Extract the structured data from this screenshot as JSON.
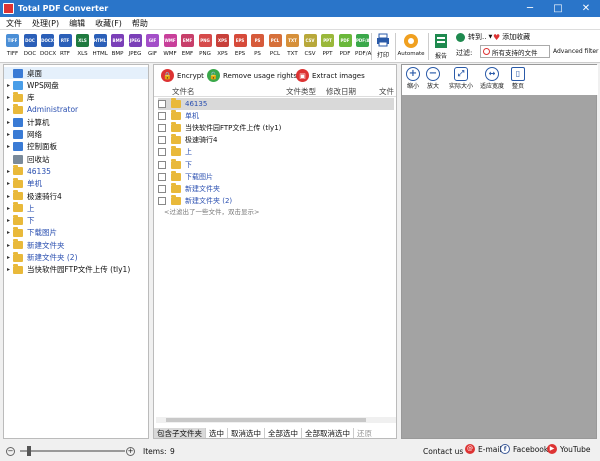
{
  "window": {
    "title": "Total PDF Converter",
    "minimize": "─",
    "maximize": "□",
    "close": "✕"
  },
  "menu": [
    "文件",
    "处理(P)",
    "编辑",
    "收藏(F)",
    "帮助"
  ],
  "formats": [
    {
      "label": "TIFF",
      "color": "#4a8ed6"
    },
    {
      "label": "DOC",
      "color": "#2b5fb8"
    },
    {
      "label": "DOCX",
      "color": "#2b5fb8"
    },
    {
      "label": "RTF",
      "color": "#2b5fb8"
    },
    {
      "label": "XLS",
      "color": "#1f7a3f"
    },
    {
      "label": "HTML",
      "color": "#2b5fb8"
    },
    {
      "label": "BMP",
      "color": "#7b3fb8"
    },
    {
      "label": "JPEG",
      "color": "#7b3fb8"
    },
    {
      "label": "GIF",
      "color": "#a34fc8"
    },
    {
      "label": "WMF",
      "color": "#c83f9a"
    },
    {
      "label": "EMF",
      "color": "#c83f6a"
    },
    {
      "label": "PNG",
      "color": "#d64a4a"
    },
    {
      "label": "XPS",
      "color": "#c8403a"
    },
    {
      "label": "EPS",
      "color": "#d64a3a"
    },
    {
      "label": "PS",
      "color": "#d65a3a"
    },
    {
      "label": "PCL",
      "color": "#d6703a"
    },
    {
      "label": "TXT",
      "color": "#d6903a"
    },
    {
      "label": "CSV",
      "color": "#b8a83a"
    },
    {
      "label": "PPT",
      "color": "#9ab83a"
    },
    {
      "label": "PDF",
      "color": "#6ab83a"
    },
    {
      "label": "PDF/A",
      "color": "#3aa84a"
    }
  ],
  "toolbar": {
    "print": "打印",
    "automate": "Automate",
    "report": "报告",
    "convert_to": "转到..",
    "add_favorite": "添加收藏",
    "filter_label": "过滤:",
    "filter_value": "所有支持的文件",
    "advanced_filter": "Advanced filter"
  },
  "tree": [
    {
      "label": "桌面",
      "arrow": "",
      "blue": false,
      "icon": "desktop"
    },
    {
      "label": "WPS网盘",
      "arrow": "▸",
      "blue": false,
      "icon": "cloud"
    },
    {
      "label": "库",
      "arrow": "▸",
      "blue": false,
      "icon": "folder"
    },
    {
      "label": "Administrator",
      "arrow": "▸",
      "blue": true,
      "icon": "folder"
    },
    {
      "label": "计算机",
      "arrow": "▸",
      "blue": false,
      "icon": "computer"
    },
    {
      "label": "网络",
      "arrow": "▸",
      "blue": false,
      "icon": "network"
    },
    {
      "label": "控制面板",
      "arrow": "▸",
      "blue": false,
      "icon": "control"
    },
    {
      "label": "回收站",
      "arrow": "",
      "blue": false,
      "icon": "bin"
    },
    {
      "label": "46135",
      "arrow": "▸",
      "blue": true,
      "icon": "folder"
    },
    {
      "label": "单机",
      "arrow": "▸",
      "blue": true,
      "icon": "folder"
    },
    {
      "label": "极速骑行4",
      "arrow": "▸",
      "blue": false,
      "icon": "folder"
    },
    {
      "label": "上",
      "arrow": "▸",
      "blue": true,
      "icon": "folder"
    },
    {
      "label": "下",
      "arrow": "▸",
      "blue": true,
      "icon": "folder"
    },
    {
      "label": "下载图片",
      "arrow": "▸",
      "blue": true,
      "icon": "folder"
    },
    {
      "label": "新建文件夹",
      "arrow": "▸",
      "blue": true,
      "icon": "folder"
    },
    {
      "label": "新建文件夹 (2)",
      "arrow": "▸",
      "blue": true,
      "icon": "folder"
    },
    {
      "label": "当快软件园FTP文件上传 (tly1)",
      "arrow": "▸",
      "blue": false,
      "icon": "folder"
    }
  ],
  "actions": {
    "encrypt": "Encrypt",
    "remove_rights": "Remove usage rights",
    "extract_images": "Extract images"
  },
  "columns": {
    "name": "文件名",
    "type": "文件类型",
    "modified": "修改日期",
    "extra": "文件"
  },
  "files": [
    {
      "label": "46135",
      "blue": true,
      "selected": true
    },
    {
      "label": "单机",
      "blue": true,
      "selected": false
    },
    {
      "label": "当快软件园FTP文件上传 (tly1)",
      "blue": false,
      "selected": false
    },
    {
      "label": "极速骑行4",
      "blue": false,
      "selected": false
    },
    {
      "label": "上",
      "blue": true,
      "selected": false
    },
    {
      "label": "下",
      "blue": true,
      "selected": false
    },
    {
      "label": "下载图片",
      "blue": true,
      "selected": false
    },
    {
      "label": "新建文件夹",
      "blue": true,
      "selected": false
    },
    {
      "label": "新建文件夹 (2)",
      "blue": true,
      "selected": false
    }
  ],
  "filter_hint": "<过滤出了一些文件，双击显示>",
  "bottom_tabs": [
    "包含子文件夹",
    "选中",
    "取消选中",
    "全部选中",
    "全部取消选中",
    "还原"
  ],
  "preview_tools": {
    "zoom_in": "缩小",
    "zoom_out": "放大",
    "actual_size": "实际大小",
    "fit_width": "适应宽度",
    "full_page": "整页"
  },
  "status": {
    "items_label": "Items:",
    "items_count": "9",
    "contact": "Contact us",
    "email": "E-mail",
    "facebook": "Facebook",
    "youtube": "YouTube"
  }
}
